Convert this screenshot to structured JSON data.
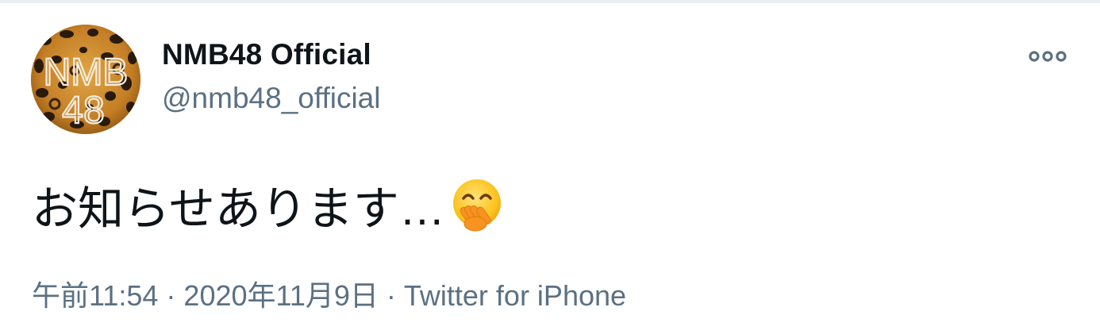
{
  "tweet": {
    "user": {
      "display_name": "NMB48 Official",
      "handle": "@nmb48_official",
      "avatar": "leopard-print-nmb48-logo",
      "avatar_text_line1": "NMB",
      "avatar_text_line2": "48"
    },
    "more_icon": "more-dots-icon",
    "text": "お知らせあります…",
    "emoji": "face-with-hand-over-mouth-emoji",
    "time": "午前11:54",
    "date": "2020年11月9日",
    "separator": "·",
    "source": "Twitter for iPhone"
  },
  "colors": {
    "text_primary": "#0f1419",
    "text_secondary": "#5b7083",
    "border": "#e9eef1"
  }
}
